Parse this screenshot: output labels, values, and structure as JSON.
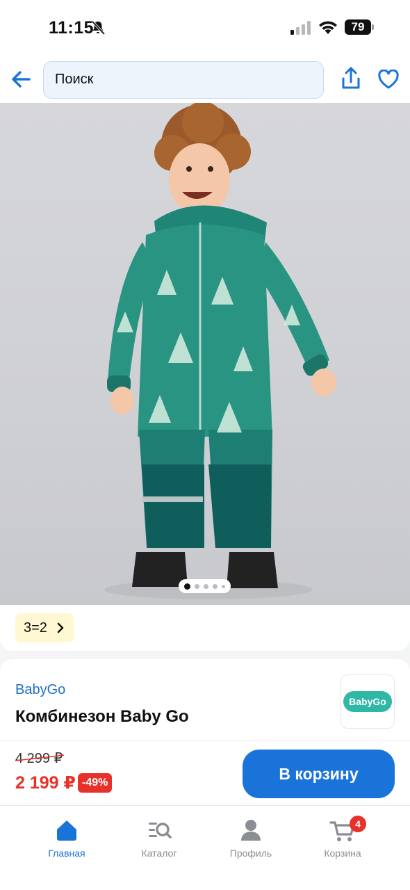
{
  "status_bar": {
    "time": "11:15",
    "battery": "79",
    "icons": [
      "bell-slash-icon",
      "signal-icon",
      "wifi-icon",
      "battery-icon"
    ]
  },
  "header": {
    "search_placeholder": "Поиск",
    "icons": [
      "back-arrow-icon",
      "share-icon",
      "heart-icon"
    ]
  },
  "gallery": {
    "image_count": 5,
    "active_index": 0
  },
  "promo": {
    "label": "3=2",
    "icon": "chevron-right-icon"
  },
  "product": {
    "brand": "BabyGo",
    "title": "Комбинезон Baby Go",
    "logo_text": "BabyGo",
    "old_price": "4 299 ₽",
    "price": "2 199 ₽",
    "discount": "-49%",
    "add_to_cart": "В корзину"
  },
  "tabbar": {
    "items": [
      {
        "label": "Главная",
        "icon": "home-icon",
        "active": true
      },
      {
        "label": "Каталог",
        "icon": "catalog-search-icon",
        "active": false
      },
      {
        "label": "Профиль",
        "icon": "profile-icon",
        "active": false
      },
      {
        "label": "Корзина",
        "icon": "cart-icon",
        "active": false,
        "badge": "4"
      }
    ]
  },
  "colors": {
    "accent": "#1a73d9",
    "price_red": "#e8312a",
    "promo_bg": "#fff8d3",
    "brand_teal": "#2fb8a6"
  }
}
